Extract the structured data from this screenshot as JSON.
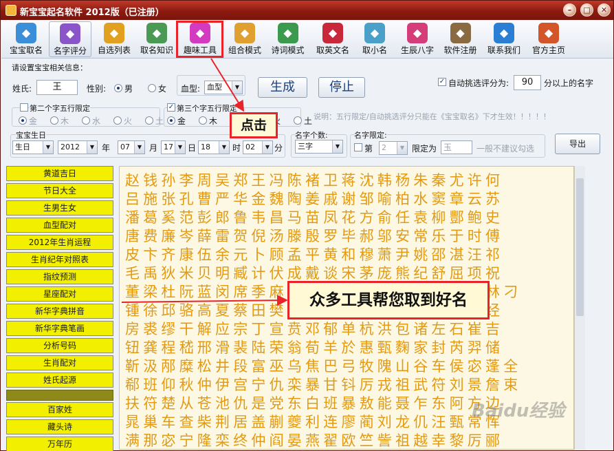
{
  "window": {
    "title": "新宝宝起名软件 2012版（已注册）",
    "min": "–",
    "max": "□",
    "close": "✕"
  },
  "toolbar": [
    {
      "label": "宝宝取名",
      "icon": "baby-people-icon",
      "color": "#3a8fd8"
    },
    {
      "label": "名字评分",
      "icon": "rating-star-icon",
      "color": "#8a55c8"
    },
    {
      "label": "自选列表",
      "icon": "star-list-icon",
      "color": "#e2a020"
    },
    {
      "label": "取名知识",
      "icon": "notebook-icon",
      "color": "#4a9a55"
    },
    {
      "label": "趣味工具",
      "icon": "gear-icon",
      "color": "#d43ac0"
    },
    {
      "label": "组合模式",
      "icon": "magnifier-icon",
      "color": "#e0a030"
    },
    {
      "label": "诗词模式",
      "icon": "poem-reader-icon",
      "color": "#3c9a4e"
    },
    {
      "label": "取英文名",
      "icon": "us-flag-icon",
      "color": "#c8283a"
    },
    {
      "label": "取小名",
      "icon": "map-pin-icon",
      "color": "#4aa0c8"
    },
    {
      "label": "生辰八字",
      "icon": "eight-chars-icon",
      "color": "#d43c7a"
    },
    {
      "label": "软件注册",
      "icon": "tools-icon",
      "color": "#8a6a40"
    },
    {
      "label": "联系我们",
      "icon": "contact-icon",
      "color": "#2a7fd4"
    },
    {
      "label": "官方主页",
      "icon": "home-icon",
      "color": "#d2562a"
    }
  ],
  "settings": {
    "group_title": "请设置宝宝相关信息：",
    "surname_label": "姓氏:",
    "surname_value": "王",
    "gender_label": "性别:",
    "gender_male": "男",
    "gender_female": "女",
    "blood_label": "血型:",
    "blood_value": "血型",
    "generate": "生成",
    "stop": "停止",
    "auto_pick_label": "自动挑选评分为:",
    "auto_pick_value": "90",
    "auto_pick_suffix": "分以上的名字",
    "second_char_label": "第二个字五行限定",
    "third_char_label": "第三个字五行限定",
    "elements": [
      "金",
      "木",
      "水",
      "火",
      "土"
    ],
    "note": "说明：五行限定/自动挑选评分只能在《宝宝取名》下才生效！！！！！",
    "birthday_label": "宝宝生日",
    "day_type": "生日",
    "year": "2012",
    "year_unit": "年",
    "month": "07",
    "month_unit": "月",
    "day": "17",
    "day_unit": "日",
    "hour": "18",
    "hour_unit": "时",
    "minute": "02",
    "minute_unit": "分",
    "name_len_label": "名字个数:",
    "name_len_value": "三字",
    "name_limit_label": "名字限定:",
    "limit_pos_label": "第",
    "limit_pos_value": "2",
    "limit_as_label": "限定为",
    "limit_char": "玉",
    "limit_hint": "一般不建议勾选",
    "export": "导出"
  },
  "sidebar": [
    "黄道吉日",
    "节日大全",
    "生男生女",
    "血型配对",
    "2012年生肖运程",
    "生肖纪年对照表",
    "指纹预测",
    "星座配对",
    "新华字典拼音",
    "新华字典笔画",
    "分析号码",
    "生肖配对",
    "姓氏起源",
    "",
    "百家姓",
    "藏头诗",
    "万年历"
  ],
  "surnames": [
    "赵钱孙李周吴郑王冯陈褚卫蒋沈韩杨朱秦尤许何",
    "吕施张孔曹严华金魏陶姜戚谢邹喻柏水窦章云苏",
    "潘葛奚范彭郎鲁韦昌马苗凤花方俞任袁柳酆鲍史",
    "唐费廉岑薛雷贺倪汤滕殷罗毕郝邬安常乐于时傅",
    "皮卞齐康伍余元卜顾孟平黄和穆萧尹姚邵湛汪祁",
    "毛禹狄米贝明臧计伏成戴谈宋茅庞熊纪舒屈项祝",
    "董梁杜阮蓝闵席季麻强贾路娄危江童颜郭梅盛林刁",
    "锺徐邱骆高夏蔡田樊胡凌霍虞万支柯昝管卢莫经",
    "房裘缪干解应宗丁宣贲邓郁单杭洪包诸左石崔吉",
    "钮龚程嵇邢滑裴陆荣翁荀羊於惠甄麴家封芮羿储",
    "靳汲邴糜松井段富巫乌焦巴弓牧隗山谷车侯宓蓬全",
    "郗班仰秋仲伊宫宁仇栾暴甘钭厉戎祖武符刘景詹束",
    "扶符楚从苍池仇是党东白班暴敖能聂乍东阿方边",
    "晁巢车查柴荆居盖蒯夔利连廖蔺刘龙仉汪甄常恽",
    "满那宓宁隆栾终仲阎晏燕翟欧竺訾祖越幸黎厉郦"
  ],
  "annotations": {
    "click_label": "点击",
    "tools_label": "众多工具帮您取到好名"
  },
  "watermark": "Baidu经验"
}
